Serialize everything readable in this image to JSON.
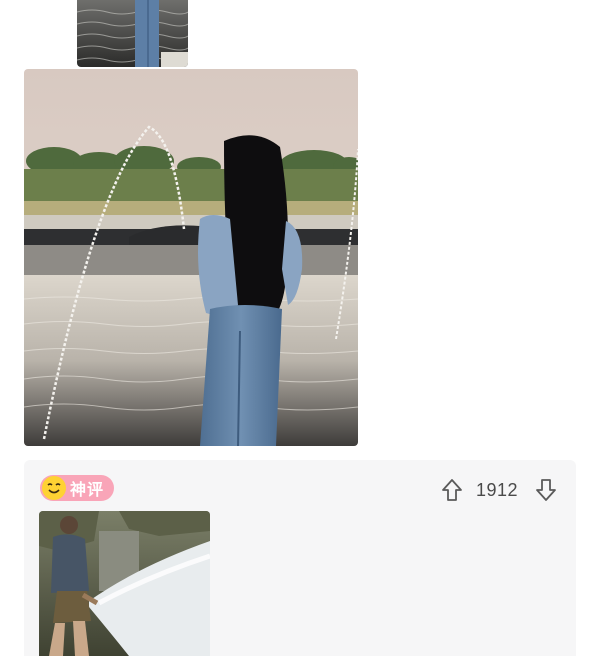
{
  "comment": {
    "badge_label": "神评",
    "badge_icon": "smiley-face-icon",
    "vote_count": "1912",
    "upvote_icon": "arrow-up-icon",
    "downvote_icon": "arrow-down-icon"
  },
  "colors": {
    "badge_bg": "#f9a5b8",
    "badge_face": "#ffd233",
    "card_bg": "#f6f6f7",
    "vote_text": "#4a4a4a"
  }
}
